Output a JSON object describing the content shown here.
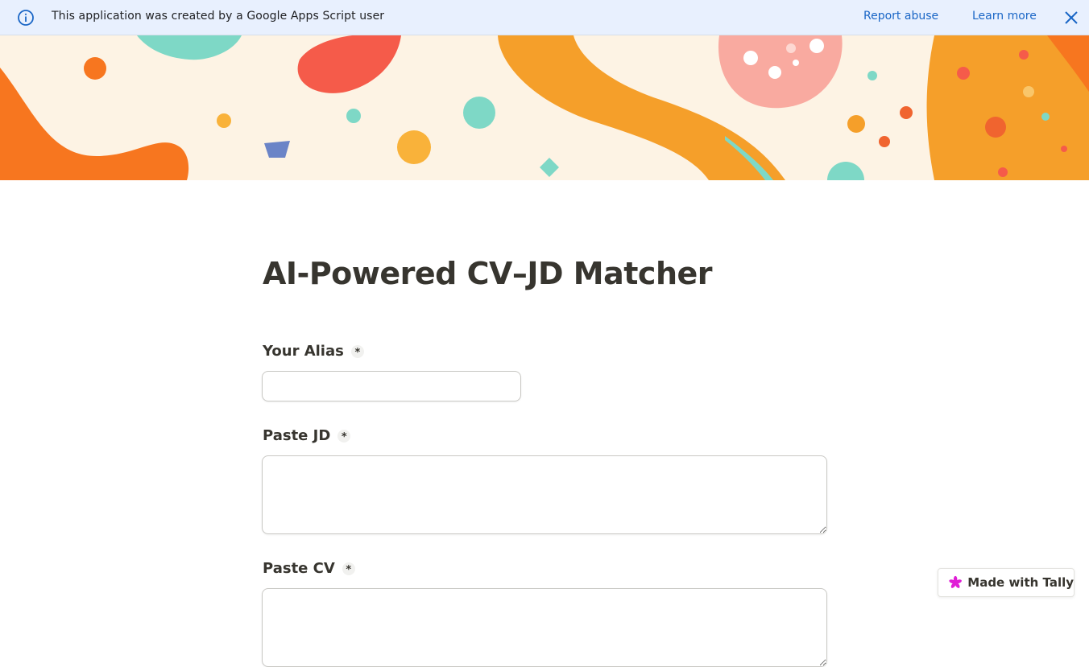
{
  "banner": {
    "message": "This application was created by a Google Apps Script user",
    "report_abuse": "Report abuse",
    "learn_more": "Learn more",
    "info_icon": "info-icon",
    "close_icon": "close-icon"
  },
  "form": {
    "title": "AI-Powered CV–JD Matcher",
    "questions": [
      {
        "label": "Your Alias",
        "required_mark": "*",
        "value": ""
      },
      {
        "label": "Paste JD",
        "required_mark": "*",
        "value": ""
      },
      {
        "label": "Paste CV",
        "required_mark": "*",
        "value": ""
      }
    ]
  },
  "badge": {
    "label": "Made with Tally",
    "icon": "tally-asterisk-icon"
  },
  "colors": {
    "banner_bg": "#e8f0fe",
    "link": "#1a66c6",
    "text": "#37352f",
    "tally_pink": "#e01fd6"
  }
}
